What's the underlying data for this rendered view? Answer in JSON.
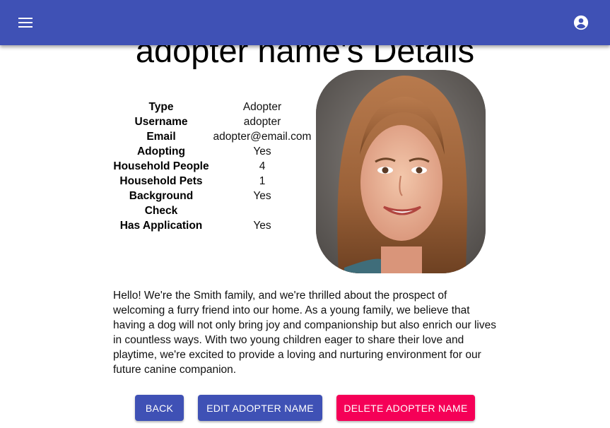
{
  "appbar": {
    "menu_icon": "menu-icon",
    "account_icon": "account-circle-icon",
    "color": "#3f51b5"
  },
  "page": {
    "title": "adopter name's Details"
  },
  "details": {
    "rows": [
      {
        "key": "Type",
        "value": "Adopter"
      },
      {
        "key": "Username",
        "value": "adopter"
      },
      {
        "key": "Email",
        "value": "adopter@email.com"
      },
      {
        "key": "Adopting",
        "value": "Yes"
      },
      {
        "key": "Household People",
        "value": "4"
      },
      {
        "key": "Household Pets",
        "value": "1"
      },
      {
        "key": "Background Check",
        "value": "Yes"
      },
      {
        "key": "Has Application",
        "value": "Yes"
      }
    ]
  },
  "bio": "Hello! We're the Smith family, and we're thrilled about the prospect of welcoming a furry friend into our home. As a young family, we believe that having a dog will not only bring joy and companionship but also enrich our lives in countless ways. With two young children eager to share their love and playtime, we're excited to provide a loving and nurturing environment for our future canine companion.",
  "actions": {
    "back_label": "BACK",
    "edit_label": "EDIT ADOPTER NAME",
    "delete_label": "DELETE ADOPTER NAME",
    "primary_color": "#3f51b5",
    "danger_color": "#f50057"
  }
}
